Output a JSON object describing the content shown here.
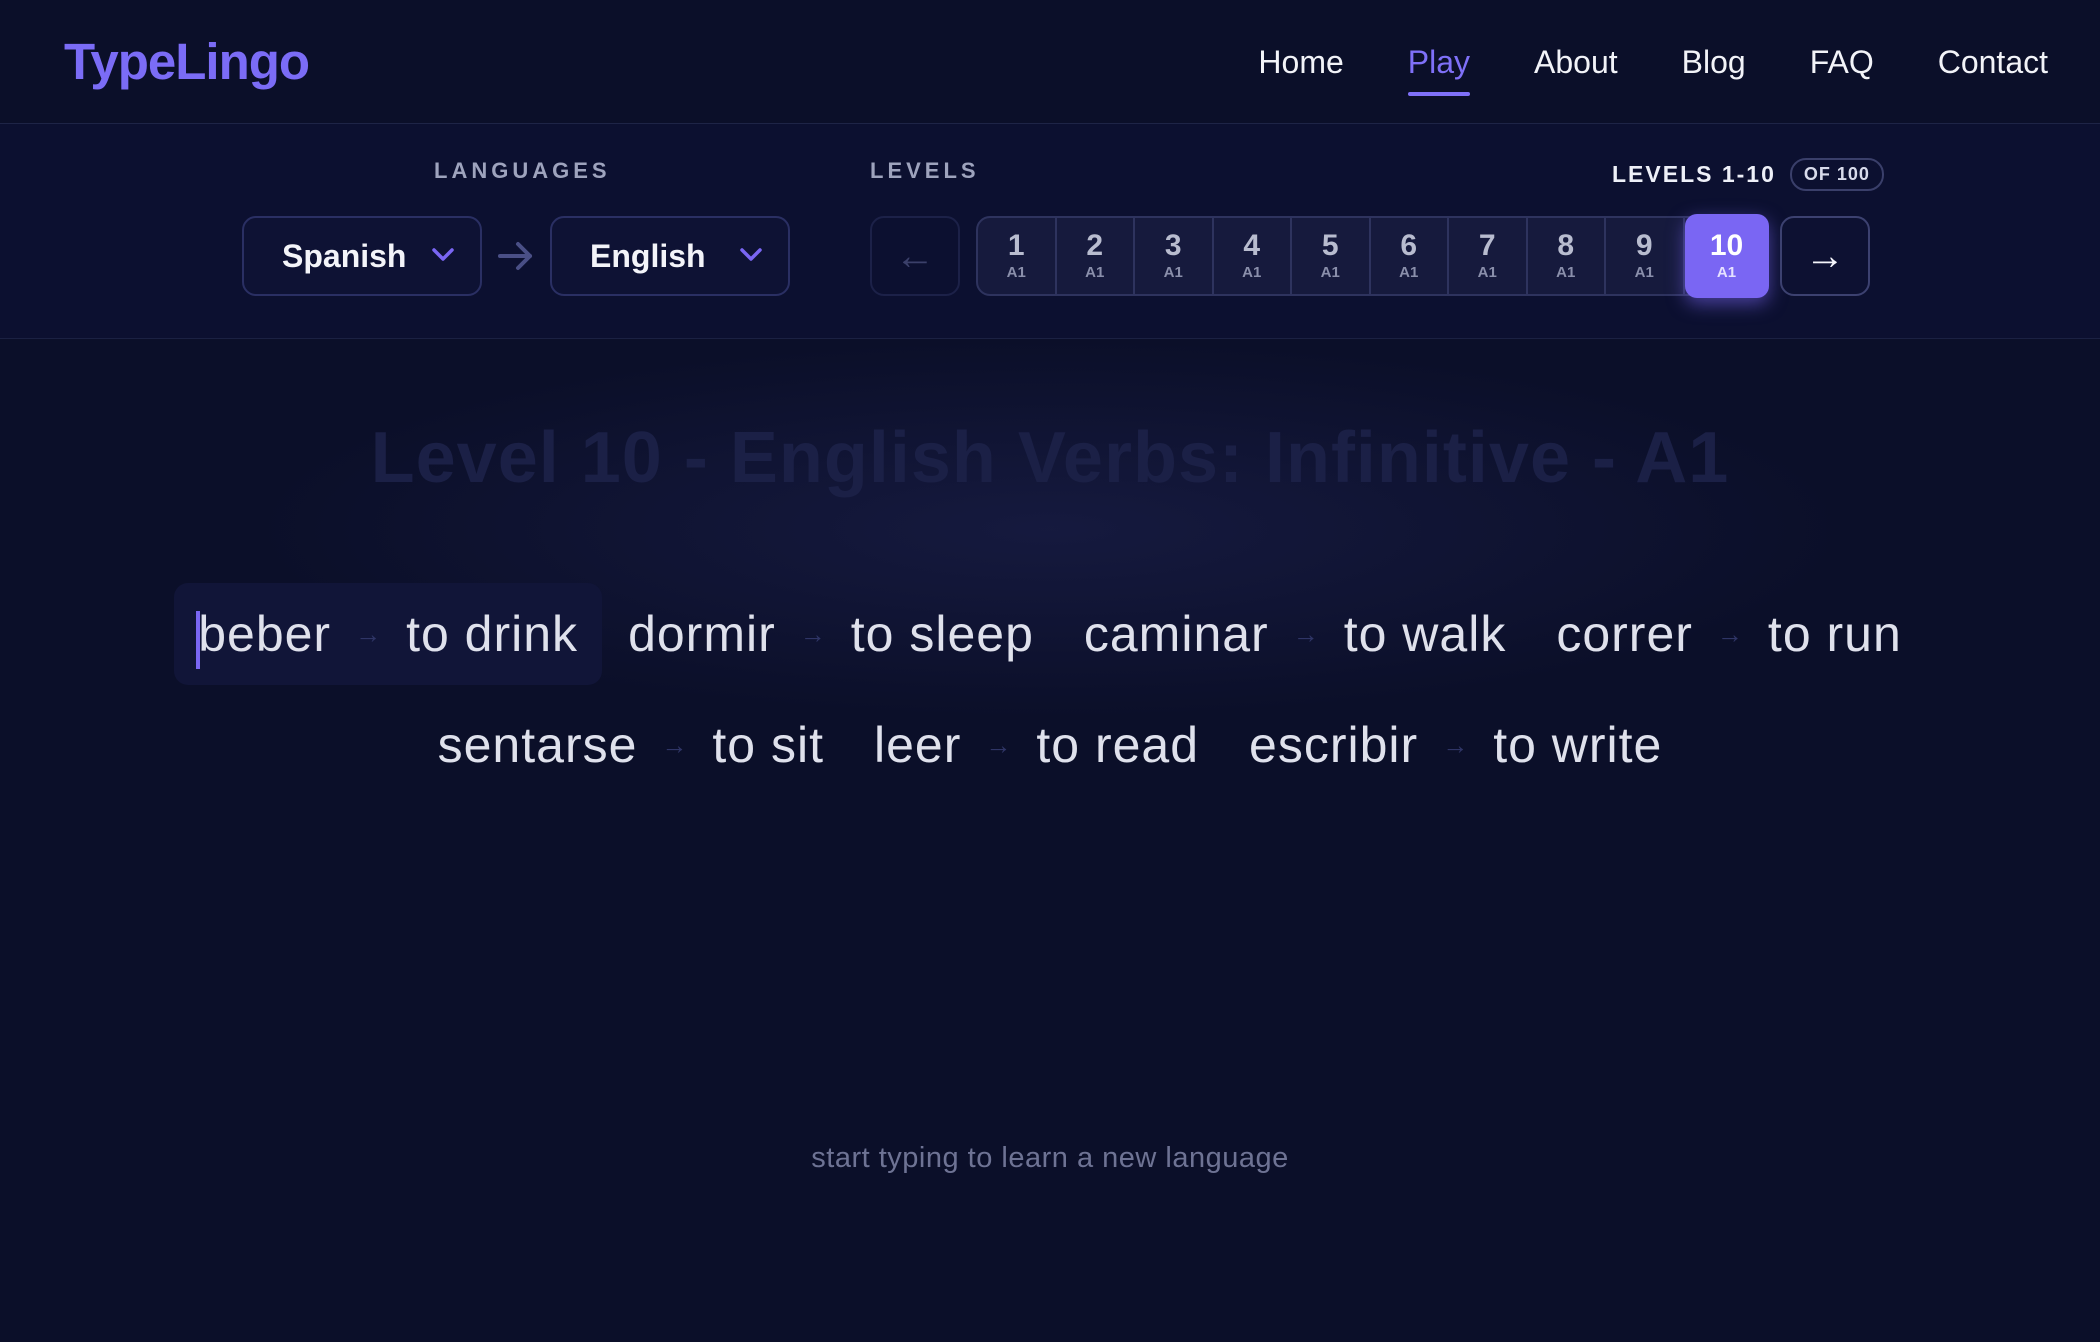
{
  "header": {
    "logo": "TypeLingo",
    "nav": [
      {
        "label": "Home",
        "active": false
      },
      {
        "label": "Play",
        "active": true
      },
      {
        "label": "About",
        "active": false
      },
      {
        "label": "Blog",
        "active": false
      },
      {
        "label": "FAQ",
        "active": false
      },
      {
        "label": "Contact",
        "active": false
      }
    ]
  },
  "controls": {
    "languages_label": "LANGUAGES",
    "levels_label": "LEVELS",
    "from_language": "Spanish",
    "to_language": "English",
    "levels_range": "LEVELS 1-10",
    "levels_total": "OF 100",
    "prev_icon": "←",
    "next_icon": "→",
    "levels": [
      {
        "num": "1",
        "cefr": "A1"
      },
      {
        "num": "2",
        "cefr": "A1"
      },
      {
        "num": "3",
        "cefr": "A1"
      },
      {
        "num": "4",
        "cefr": "A1"
      },
      {
        "num": "5",
        "cefr": "A1"
      },
      {
        "num": "6",
        "cefr": "A1"
      },
      {
        "num": "7",
        "cefr": "A1"
      },
      {
        "num": "8",
        "cefr": "A1"
      },
      {
        "num": "9",
        "cefr": "A1"
      },
      {
        "num": "10",
        "cefr": "A1"
      }
    ],
    "active_level": "10"
  },
  "main": {
    "title": "Level 10 - English Verbs: Infinitive - A1",
    "pairs_row1": [
      {
        "source": "beber",
        "target": "to drink"
      },
      {
        "source": "dormir",
        "target": "to sleep"
      },
      {
        "source": "caminar",
        "target": "to walk"
      },
      {
        "source": "correr",
        "target": "to run"
      }
    ],
    "pairs_row2": [
      {
        "source": "sentarse",
        "target": "to sit"
      },
      {
        "source": "leer",
        "target": "to read"
      },
      {
        "source": "escribir",
        "target": "to write"
      }
    ],
    "arrow_glyph": "→",
    "hint": "start typing to learn a new language"
  },
  "colors": {
    "background": "#0b0f29",
    "accent": "#7a66f3",
    "text": "#e6e8f2"
  }
}
